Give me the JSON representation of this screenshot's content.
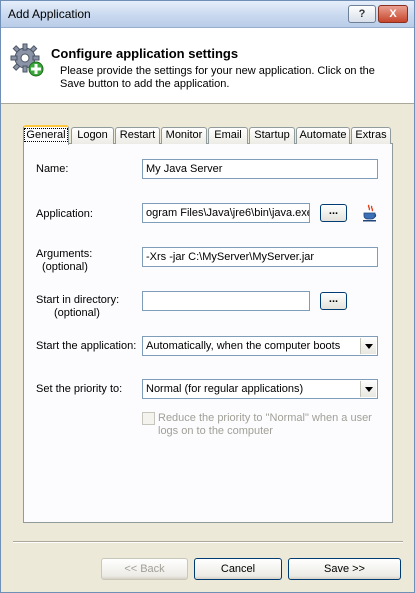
{
  "window": {
    "title": "Add Application",
    "help_label": "?",
    "close_label": "X"
  },
  "header": {
    "title": "Configure application settings",
    "description": "Please provide the settings for your new application. Click on the Save button to add the application."
  },
  "tabs": [
    {
      "label": "General",
      "active": true
    },
    {
      "label": "Logon"
    },
    {
      "label": "Restart"
    },
    {
      "label": "Monitor"
    },
    {
      "label": "Email"
    },
    {
      "label": "Startup"
    },
    {
      "label": "Automate"
    },
    {
      "label": "Extras"
    }
  ],
  "form": {
    "name_label": "Name:",
    "name_value": "My Java Server",
    "application_label": "Application:",
    "application_value": "ogram Files\\Java\\jre6\\bin\\java.exe",
    "browse_label": "...",
    "arguments_label": "Arguments:",
    "arguments_optional": "(optional)",
    "arguments_value": "-Xrs -jar C:\\MyServer\\MyServer.jar",
    "start_dir_label": "Start in directory:",
    "start_dir_optional": "(optional)",
    "start_dir_value": "",
    "start_app_label": "Start the application:",
    "start_app_value": "Automatically, when the computer boots",
    "priority_label": "Set the priority to:",
    "priority_value": "Normal (for regular applications)",
    "reduce_priority_label": "Reduce the priority to \"Normal\" when a user logs on to the computer",
    "reduce_priority_checked": false
  },
  "buttons": {
    "back": "<< Back",
    "cancel": "Cancel",
    "save": "Save >>"
  },
  "icons": {
    "header_icon": "gear-add-icon",
    "java_icon": "java-cup-icon"
  }
}
